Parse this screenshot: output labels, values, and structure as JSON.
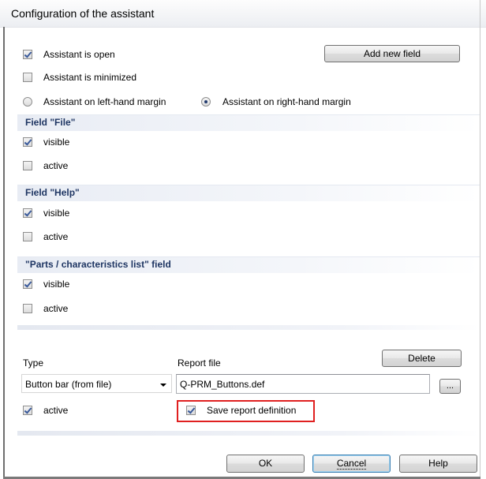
{
  "window": {
    "title": "Configuration of the assistant"
  },
  "general": {
    "open_label": "Assistant is open",
    "open_checked": true,
    "minimized_label": "Assistant is minimized",
    "minimized_checked": false,
    "left_margin_label": "Assistant on left-hand margin",
    "right_margin_label": "Assistant on right-hand margin",
    "margin_selected": "right",
    "add_field_label": "Add new field"
  },
  "sections": [
    {
      "title": "Field \"File\"",
      "visible_label": "visible",
      "visible_checked": true,
      "active_label": "active",
      "active_checked": false
    },
    {
      "title": "Field \"Help\"",
      "visible_label": "visible",
      "visible_checked": true,
      "active_label": "active",
      "active_checked": false
    },
    {
      "title": "\"Parts / characteristics list\" field",
      "visible_label": "visible",
      "visible_checked": true,
      "active_label": "active",
      "active_checked": false
    }
  ],
  "report": {
    "type_label": "Type",
    "type_value": "Button bar (from file)",
    "report_file_label": "Report file",
    "report_file_value": "Q-PRM_Buttons.def",
    "browse_label": "...",
    "delete_label": "Delete",
    "active_label": "active",
    "active_checked": true,
    "save_def_label": "Save report definition",
    "save_def_checked": true
  },
  "footer": {
    "ok_label": "OK",
    "cancel_label": "Cancel",
    "help_label": "Help"
  },
  "colors": {
    "section_header_text": "#1f3663",
    "highlight_border": "#e02020",
    "check_mark": "#3a5a9b"
  }
}
